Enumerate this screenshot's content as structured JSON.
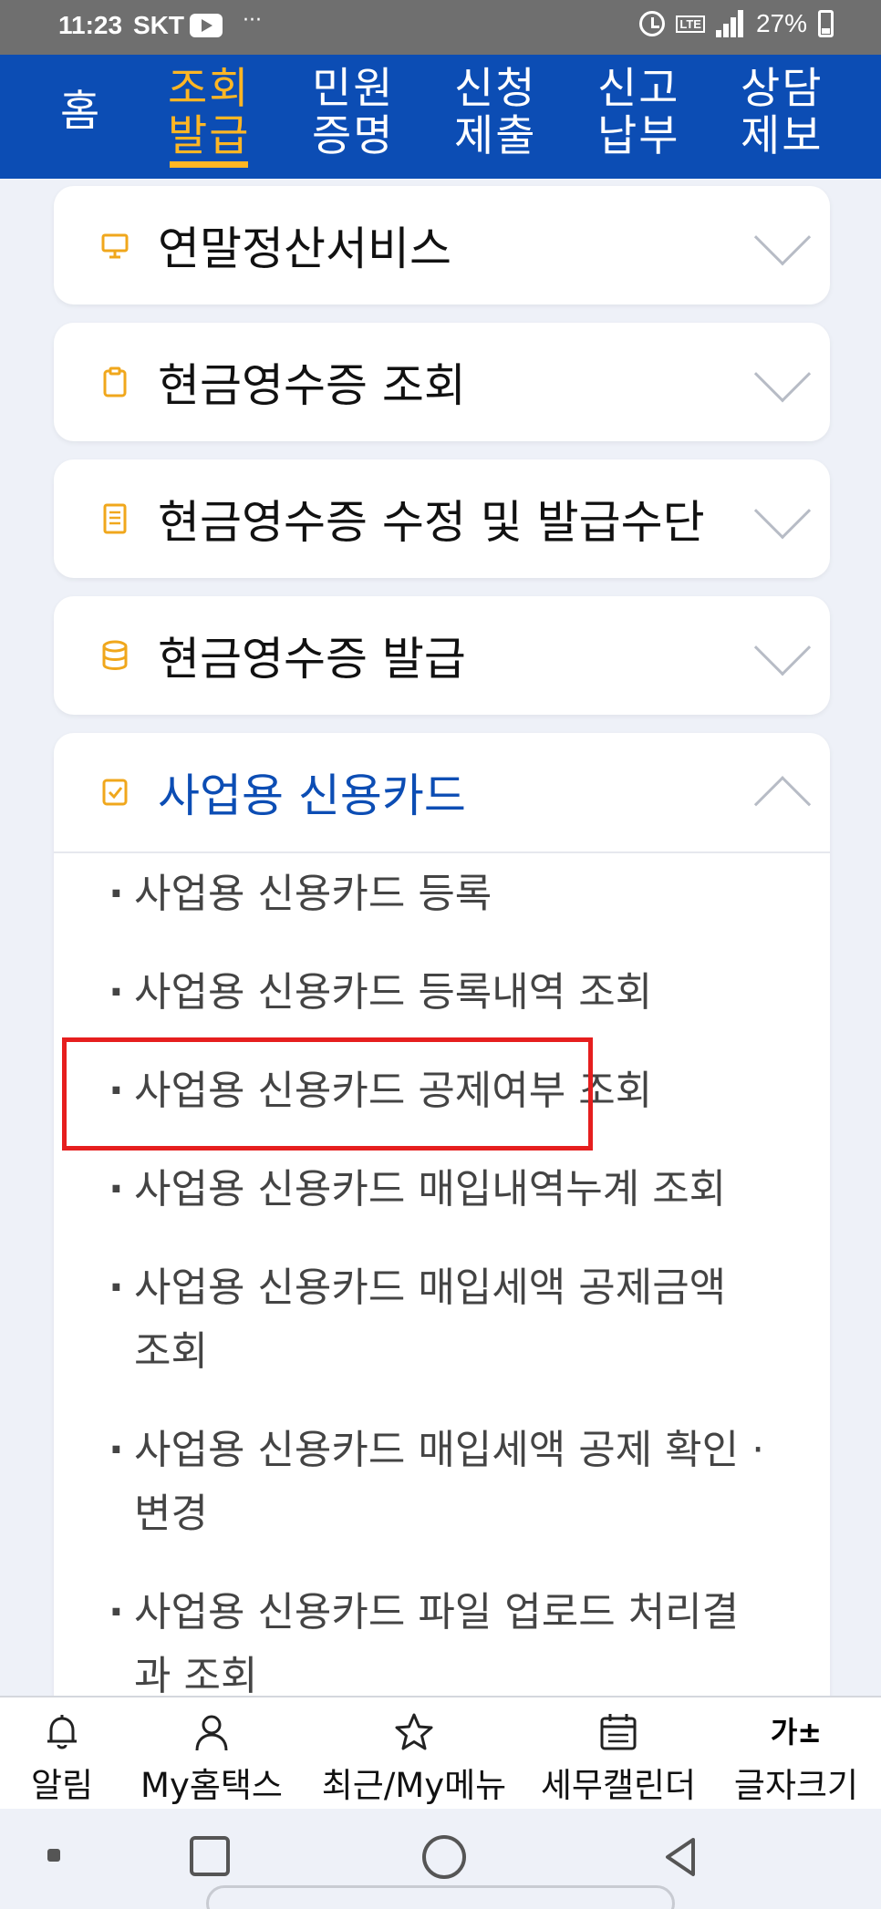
{
  "status_bar": {
    "time": "11:23",
    "carrier": "SKT",
    "dots": "···",
    "lte": "LTE",
    "battery": "27%"
  },
  "top_nav": {
    "items": [
      {
        "label": "홈"
      },
      {
        "label_line1": "조회",
        "label_line2": "발급"
      },
      {
        "label_line1": "민원",
        "label_line2": "증명"
      },
      {
        "label_line1": "신청",
        "label_line2": "제출"
      },
      {
        "label_line1": "신고",
        "label_line2": "납부"
      },
      {
        "label_line1": "상담",
        "label_line2": "제보"
      }
    ]
  },
  "menu": {
    "cards": [
      {
        "title": "연말정산서비스",
        "icon": "monitor-icon"
      },
      {
        "title": "현금영수증 조회",
        "icon": "clipboard-icon"
      },
      {
        "title": "현금영수증 수정 및 발급수단",
        "icon": "document-icon"
      },
      {
        "title": "현금영수증 발급",
        "icon": "database-icon"
      },
      {
        "title": "사업용 신용카드",
        "icon": "check-icon"
      }
    ],
    "expanded_items": [
      "사업용 신용카드 등록",
      "사업용 신용카드 등록내역 조회",
      "사업용 신용카드 공제여부 조회",
      "사업용 신용카드 매입내역누계 조회",
      "사업용 신용카드 매입세액 공제금액 조회",
      "사업용 신용카드 매입세액 공제 확인 ·변경",
      "사업용 신용카드 파일 업로드 처리결과 조회"
    ]
  },
  "bottom_nav": [
    {
      "label": "알림",
      "icon": "bell-icon"
    },
    {
      "label": "My홈택스",
      "icon": "person-icon"
    },
    {
      "label": "최근/My메뉴",
      "icon": "star-icon"
    },
    {
      "label": "세무캘린더",
      "icon": "calendar-icon"
    },
    {
      "label": "글자크기",
      "icon_text": "가±"
    }
  ],
  "colors": {
    "primary": "#0c4db4",
    "accent": "#ffb624",
    "highlight": "#e61e1e",
    "background": "#eef1f8"
  }
}
